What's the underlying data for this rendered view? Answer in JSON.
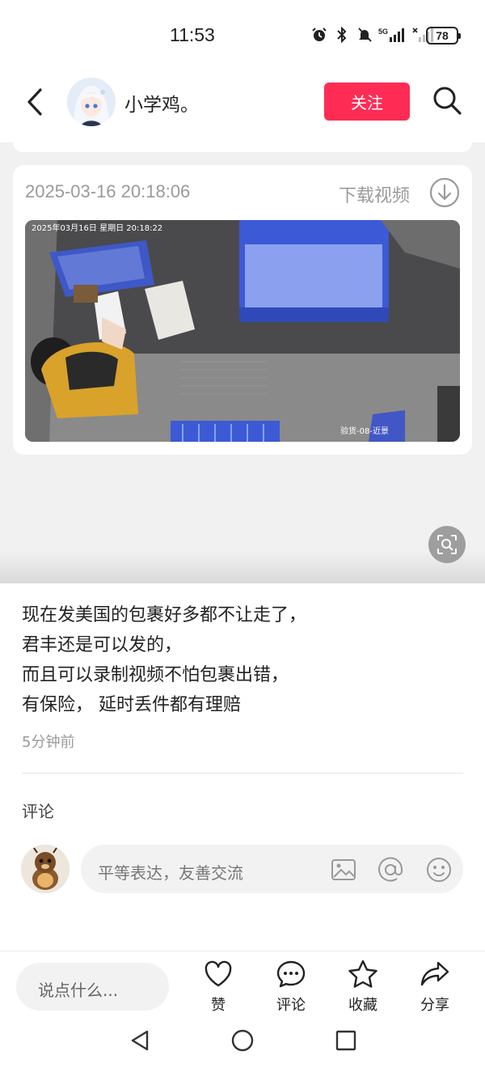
{
  "status_bar": {
    "time": "11:53",
    "battery": "78",
    "icons": [
      "alarm-icon",
      "bluetooth-icon",
      "mute-icon",
      "signal-5g-icon",
      "signal-icon"
    ]
  },
  "header": {
    "username": "小学鸡。",
    "follow_label": "关注",
    "icons": [
      "back-arrow-icon",
      "search-icon"
    ]
  },
  "video": {
    "date": "2025-03-16 20:18:06",
    "download_label": "下载视频",
    "overlay_timestamp": "2025年03月16日 星期日 20:18:22",
    "overlay_camera": "验货-08-近景"
  },
  "post": {
    "lines": [
      "现在发美国的包裹好多都不让走了，",
      "君丰还是可以发的，",
      "而且可以录制视频不怕包裹出错，",
      "有保险， 延时丢件都有理赔"
    ],
    "time_ago": "5分钟前"
  },
  "comments": {
    "title": "评论",
    "input_placeholder": "平等表达，友善交流",
    "input_icons": [
      "image-icon",
      "at-icon",
      "emoji-icon"
    ]
  },
  "bottom_bar": {
    "say_placeholder": "说点什么...",
    "actions": [
      {
        "label": "赞",
        "icon": "heart-icon"
      },
      {
        "label": "评论",
        "icon": "comment-icon"
      },
      {
        "label": "收藏",
        "icon": "star-icon"
      },
      {
        "label": "分享",
        "icon": "share-icon"
      }
    ]
  },
  "colors": {
    "accent": "#fe2c55",
    "background_gray": "#f1f1f1",
    "secondary_text": "#9a9a9a"
  }
}
